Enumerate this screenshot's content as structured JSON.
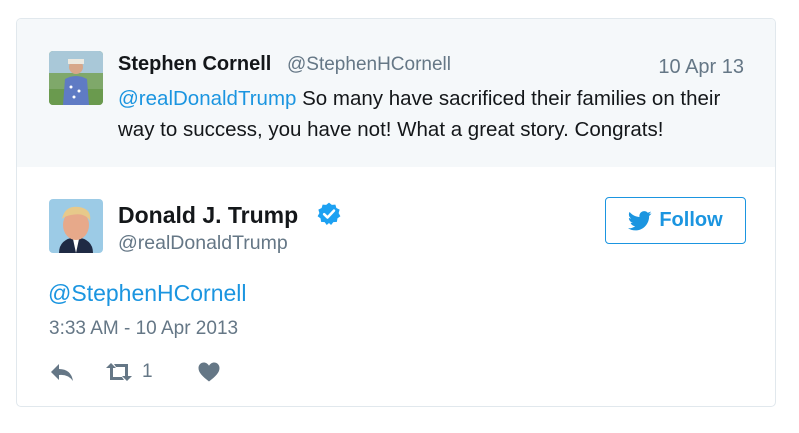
{
  "parent_tweet": {
    "name": "Stephen Cornell",
    "handle": "@StephenHCornell",
    "date": "10 Apr 13",
    "mention": "@realDonaldTrump",
    "text": " So many have sacrificed their families on their way to success, you have not! What a great story. Congrats!"
  },
  "main_tweet": {
    "name": "Donald J. Trump",
    "handle": "@realDonaldTrump",
    "verified_icon": "verified-badge-icon",
    "follow_label": "Follow",
    "text": "@StephenHCornell",
    "timestamp": "3:33 AM - 10 Apr 2013",
    "retweet_count": "1"
  },
  "colors": {
    "accent": "#1b95e0",
    "muted": "#657786",
    "text": "#14171a",
    "parent_bg": "#f5f8fa",
    "border": "#e1e8ed"
  },
  "icons": [
    "reply-icon",
    "retweet-icon",
    "like-icon",
    "twitter-bird-icon"
  ]
}
